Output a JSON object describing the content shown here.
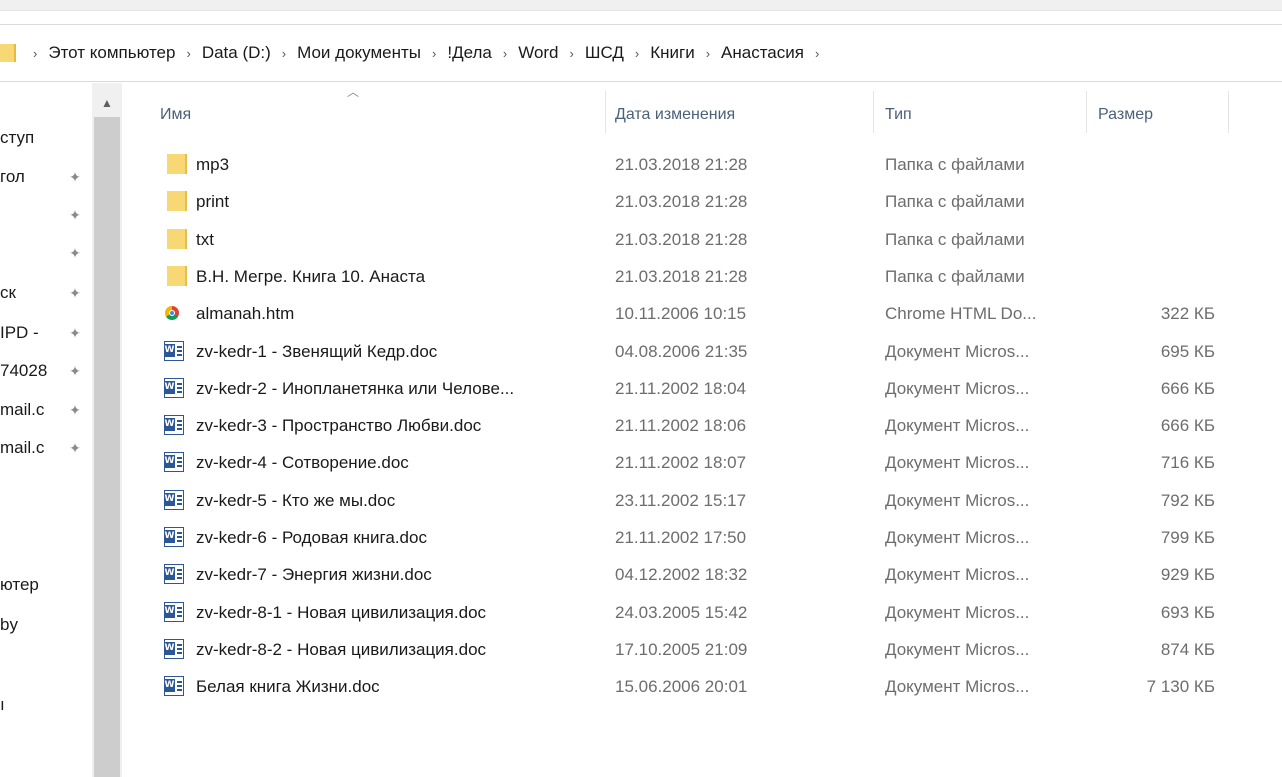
{
  "breadcrumb": [
    "Этот компьютер",
    "Data (D:)",
    "Мои документы",
    "!Дела",
    "Word",
    "ШСД",
    "Книги",
    "Анастасия"
  ],
  "breadcrumb_separator": "›",
  "navpane": {
    "items": [
      {
        "label": "ступ",
        "pinned": false
      },
      {
        "label": "гол",
        "pinned": true
      },
      {
        "label": "",
        "pinned": true
      },
      {
        "label": "",
        "pinned": true
      },
      {
        "label": "ск",
        "pinned": true
      },
      {
        "label": "IPD -",
        "pinned": true
      },
      {
        "label": "74028",
        "pinned": true
      },
      {
        "label": "mail.c",
        "pinned": true
      },
      {
        "label": "mail.c",
        "pinned": true
      },
      {
        "label": "ютер",
        "pinned": false
      },
      {
        "label": "by",
        "pinned": false
      },
      {
        "label": "ı",
        "pinned": false
      }
    ]
  },
  "columns": {
    "name": "Имя",
    "date": "Дата изменения",
    "type": "Тип",
    "size": "Размер"
  },
  "files": [
    {
      "icon": "folder-icon",
      "name": "mp3",
      "date": "21.03.2018 21:28",
      "type": "Папка с файлами",
      "size": ""
    },
    {
      "icon": "folder-icon",
      "name": "print",
      "date": "21.03.2018 21:28",
      "type": "Папка с файлами",
      "size": ""
    },
    {
      "icon": "folder-icon",
      "name": "txt",
      "date": "21.03.2018 21:28",
      "type": "Папка с файлами",
      "size": ""
    },
    {
      "icon": "folder-icon",
      "name": "В.Н. Мегре. Книга 10. Анаста",
      "date": "21.03.2018 21:28",
      "type": "Папка с файлами",
      "size": ""
    },
    {
      "icon": "chrome-html-icon",
      "name": "almanah.htm",
      "date": "10.11.2006 10:15",
      "type": "Chrome HTML Do...",
      "size": "322 КБ"
    },
    {
      "icon": "word-doc-icon",
      "name": "zv-kedr-1 - Звенящий Кедр.doc",
      "date": "04.08.2006 21:35",
      "type": "Документ Micros...",
      "size": "695 КБ"
    },
    {
      "icon": "word-doc-icon",
      "name": "zv-kedr-2 - Инопланетянка или Челове...",
      "date": "21.11.2002 18:04",
      "type": "Документ Micros...",
      "size": "666 КБ"
    },
    {
      "icon": "word-doc-icon",
      "name": "zv-kedr-3 - Пространство Любви.doc",
      "date": "21.11.2002 18:06",
      "type": "Документ Micros...",
      "size": "666 КБ"
    },
    {
      "icon": "word-doc-icon",
      "name": "zv-kedr-4 - Сотворение.doc",
      "date": "21.11.2002 18:07",
      "type": "Документ Micros...",
      "size": "716 КБ"
    },
    {
      "icon": "word-doc-icon",
      "name": "zv-kedr-5 - Кто же мы.doc",
      "date": "23.11.2002 15:17",
      "type": "Документ Micros...",
      "size": "792 КБ"
    },
    {
      "icon": "word-doc-icon",
      "name": "zv-kedr-6 - Родовая книга.doc",
      "date": "21.11.2002 17:50",
      "type": "Документ Micros...",
      "size": "799 КБ"
    },
    {
      "icon": "word-doc-icon",
      "name": "zv-kedr-7 - Энергия жизни.doc",
      "date": "04.12.2002 18:32",
      "type": "Документ Micros...",
      "size": "929 КБ"
    },
    {
      "icon": "word-doc-icon",
      "name": "zv-kedr-8-1 - Новая цивилизация.doc",
      "date": "24.03.2005 15:42",
      "type": "Документ Micros...",
      "size": "693 КБ"
    },
    {
      "icon": "word-doc-icon",
      "name": "zv-kedr-8-2 - Новая цивилизация.doc",
      "date": "17.10.2005 21:09",
      "type": "Документ Micros...",
      "size": "874 КБ"
    },
    {
      "icon": "word-doc-icon",
      "name": "Белая книга Жизни.doc",
      "date": "15.06.2006 20:01",
      "type": "Документ Micros...",
      "size": "7 130 КБ"
    }
  ],
  "colors": {
    "folder": "#f8d775",
    "word": "#2b579a",
    "header_text": "#4c607a",
    "secondary_text": "#6d6d6d"
  }
}
